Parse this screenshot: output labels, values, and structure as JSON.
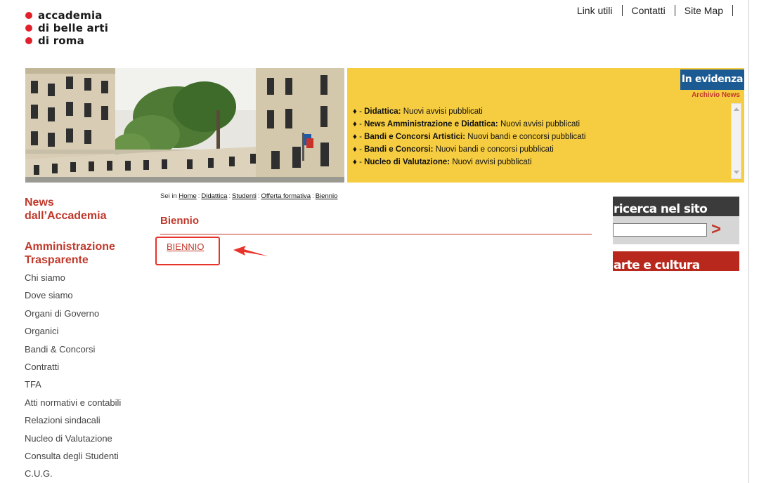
{
  "logo": {
    "lines": [
      "accademia",
      "di belle arti",
      "di roma"
    ],
    "dot_color": "#e0202b"
  },
  "top_links": [
    "Link utili",
    "Contatti",
    "Site Map"
  ],
  "banner": {
    "evidenza_label": "In evidenza",
    "archivio_label": "Archivio News",
    "news": [
      {
        "title": "Didattica:",
        "text": "Nuovi avvisi pubblicati"
      },
      {
        "title": "News Amministrazione e Didattica:",
        "text": "Nuovi avvisi pubblicati"
      },
      {
        "title": "Bandi e Concorsi Artistici:",
        "text": "Nuovi bandi e concorsi pubblicati"
      },
      {
        "title": "Bandi e Concorsi:",
        "text": "Nuovi bandi e concorsi pubblicati"
      },
      {
        "title": "Nucleo di Valutazione:",
        "text": "Nuovi avvisi pubblicati"
      }
    ],
    "bullet": "♦ - "
  },
  "left_nav": {
    "news_heading_1": "News",
    "news_heading_2": "dall’Accademia",
    "amm_heading_1": "Amministrazione",
    "amm_heading_2": "Trasparente",
    "items": [
      "Chi siamo",
      "Dove siamo",
      "Organi di Governo",
      "Organici",
      "Bandi & Concorsi",
      "Contratti",
      "TFA",
      "Atti normativi e contabili",
      "Relazioni sindacali",
      "Nucleo di Valutazione",
      "Consulta degli Studenti",
      "C.U.G."
    ]
  },
  "breadcrumb": {
    "prefix": "Sei in",
    "items": [
      "Home",
      "Didattica",
      "Studenti",
      "Offerta formativa",
      "Biennio"
    ],
    "separator": ":"
  },
  "main": {
    "page_title": "Biennio",
    "link_label": "BIENNIO"
  },
  "right": {
    "search_title": "ricerca nel sito",
    "search_value": "",
    "search_go": ">",
    "arte_title": "arte e cultura"
  },
  "colors": {
    "accent_red": "#c0392b",
    "banner_yellow": "#f6cd41",
    "evidenza_blue": "#1b5a93",
    "annotation_red": "#e8332a"
  }
}
